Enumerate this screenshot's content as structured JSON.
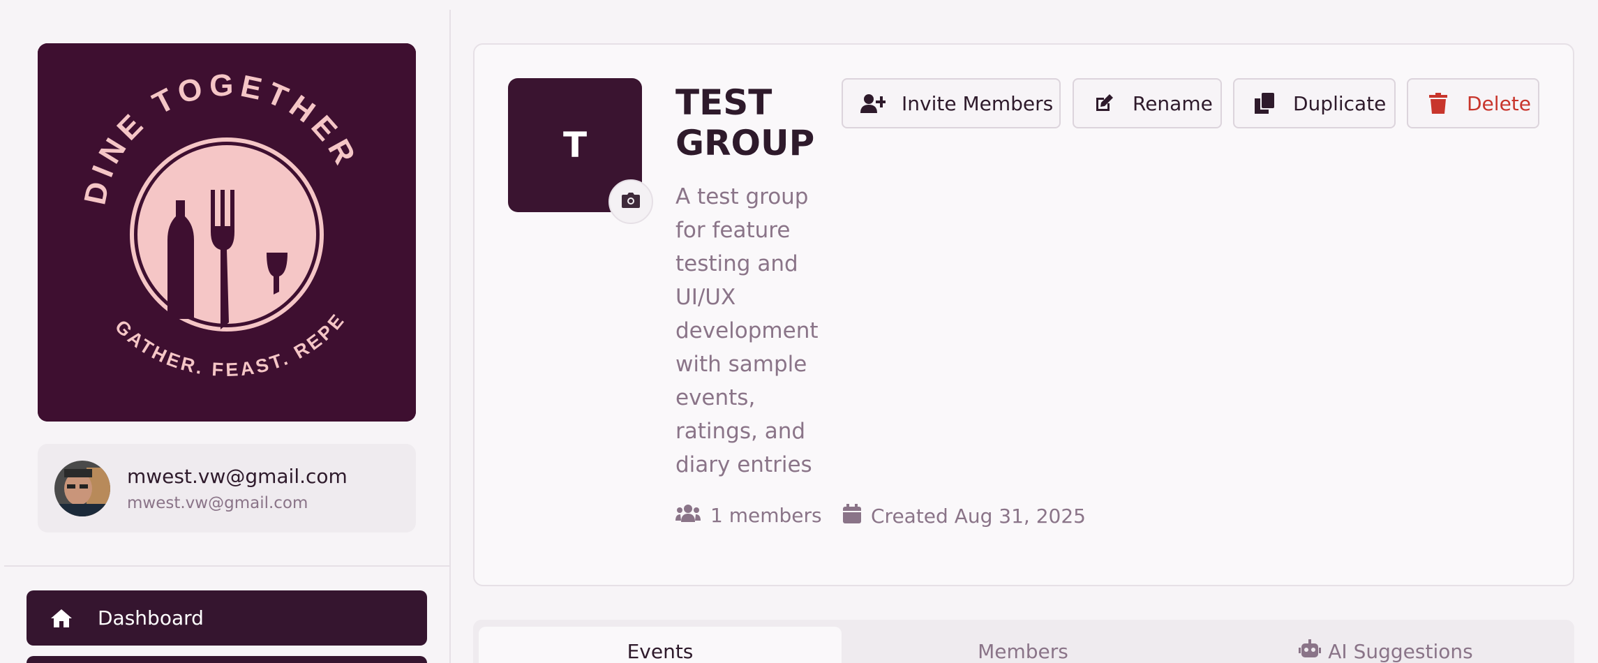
{
  "colors": {
    "brand_plum": "#3e0f30",
    "brand_pink": "#f5c6c6",
    "nav_active": "#35152f",
    "muted_text": "#8a7488",
    "danger": "#c8352c"
  },
  "brand": {
    "logo_top_text": "DINE TOGETHER",
    "logo_bottom_text": "GATHER. FEAST. REPEAT."
  },
  "user": {
    "name": "mwest.vw@gmail.com",
    "email": "mwest.vw@gmail.com"
  },
  "nav": {
    "items": [
      {
        "label": "Dashboard",
        "icon": "home-icon",
        "active": true
      }
    ]
  },
  "group": {
    "initial": "T",
    "title": "TEST GROUP",
    "description": "A test group for feature testing and UI/UX development with sample events, ratings, and diary entries",
    "members_text": "1 members",
    "created_text": "Created Aug 31, 2025"
  },
  "actions": {
    "invite": "Invite Members",
    "rename": "Rename",
    "duplicate": "Duplicate",
    "delete": "Delete"
  },
  "tabs": [
    {
      "label": "Events",
      "active": true
    },
    {
      "label": "Members",
      "active": false
    },
    {
      "label": "AI Suggestions",
      "active": false,
      "icon": "robot-icon"
    }
  ]
}
